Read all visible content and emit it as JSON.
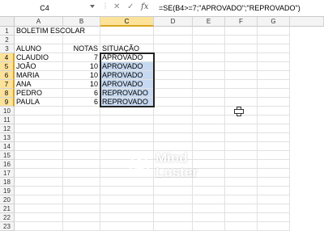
{
  "formula_bar": {
    "name_box": "C4",
    "formula": "=SE(B4>=7;\"APROVADO\";\"REPROVADO\")",
    "cancel_glyph": "✕",
    "enter_glyph": "✓",
    "fx_label": "fx"
  },
  "columns": [
    "A",
    "B",
    "C",
    "D",
    "E",
    "F",
    "G"
  ],
  "selected_column": "C",
  "rows": [
    {
      "n": "1",
      "a": "BOLETIM ESCOLAR",
      "b": "",
      "c": ""
    },
    {
      "n": "2",
      "a": "",
      "b": "",
      "c": ""
    },
    {
      "n": "3",
      "a": "ALUNO",
      "b": "NOTAS",
      "c": "SITUAÇÃO"
    },
    {
      "n": "4",
      "a": "CLAUDIO",
      "b": "7",
      "c": "APROVADO"
    },
    {
      "n": "5",
      "a": "JOÃO",
      "b": "10",
      "c": "APROVADO"
    },
    {
      "n": "6",
      "a": "MARIA",
      "b": "10",
      "c": "APROVADO"
    },
    {
      "n": "7",
      "a": "ANA",
      "b": "10",
      "c": "APROVADO"
    },
    {
      "n": "8",
      "a": "PEDRO",
      "b": "6",
      "c": "REPROVADO"
    },
    {
      "n": "9",
      "a": "PAULA",
      "b": "6",
      "c": "REPROVADO"
    },
    {
      "n": "10",
      "a": "",
      "b": "",
      "c": ""
    },
    {
      "n": "11",
      "a": "",
      "b": "",
      "c": ""
    },
    {
      "n": "12",
      "a": "",
      "b": "",
      "c": ""
    },
    {
      "n": "13",
      "a": "",
      "b": "",
      "c": ""
    },
    {
      "n": "14",
      "a": "",
      "b": "",
      "c": ""
    },
    {
      "n": "15",
      "a": "",
      "b": "",
      "c": ""
    },
    {
      "n": "16",
      "a": "",
      "b": "",
      "c": ""
    },
    {
      "n": "17",
      "a": "",
      "b": "",
      "c": ""
    },
    {
      "n": "18",
      "a": "",
      "b": "",
      "c": ""
    },
    {
      "n": "19",
      "a": "",
      "b": "",
      "c": ""
    },
    {
      "n": "20",
      "a": "",
      "b": "",
      "c": ""
    },
    {
      "n": "21",
      "a": "",
      "b": "",
      "c": ""
    },
    {
      "n": "22",
      "a": "",
      "b": "",
      "c": ""
    },
    {
      "n": "23",
      "a": "",
      "b": "",
      "c": ""
    }
  ],
  "selection": {
    "range": "C4:C9",
    "active_cell": "C4"
  },
  "watermark": {
    "line1": "Mind",
    "line2": "Luster",
    "icon": "brain-logo-icon"
  },
  "colors": {
    "selection_fill": "#c6d9f0",
    "header_highlight": "#fde29a"
  }
}
